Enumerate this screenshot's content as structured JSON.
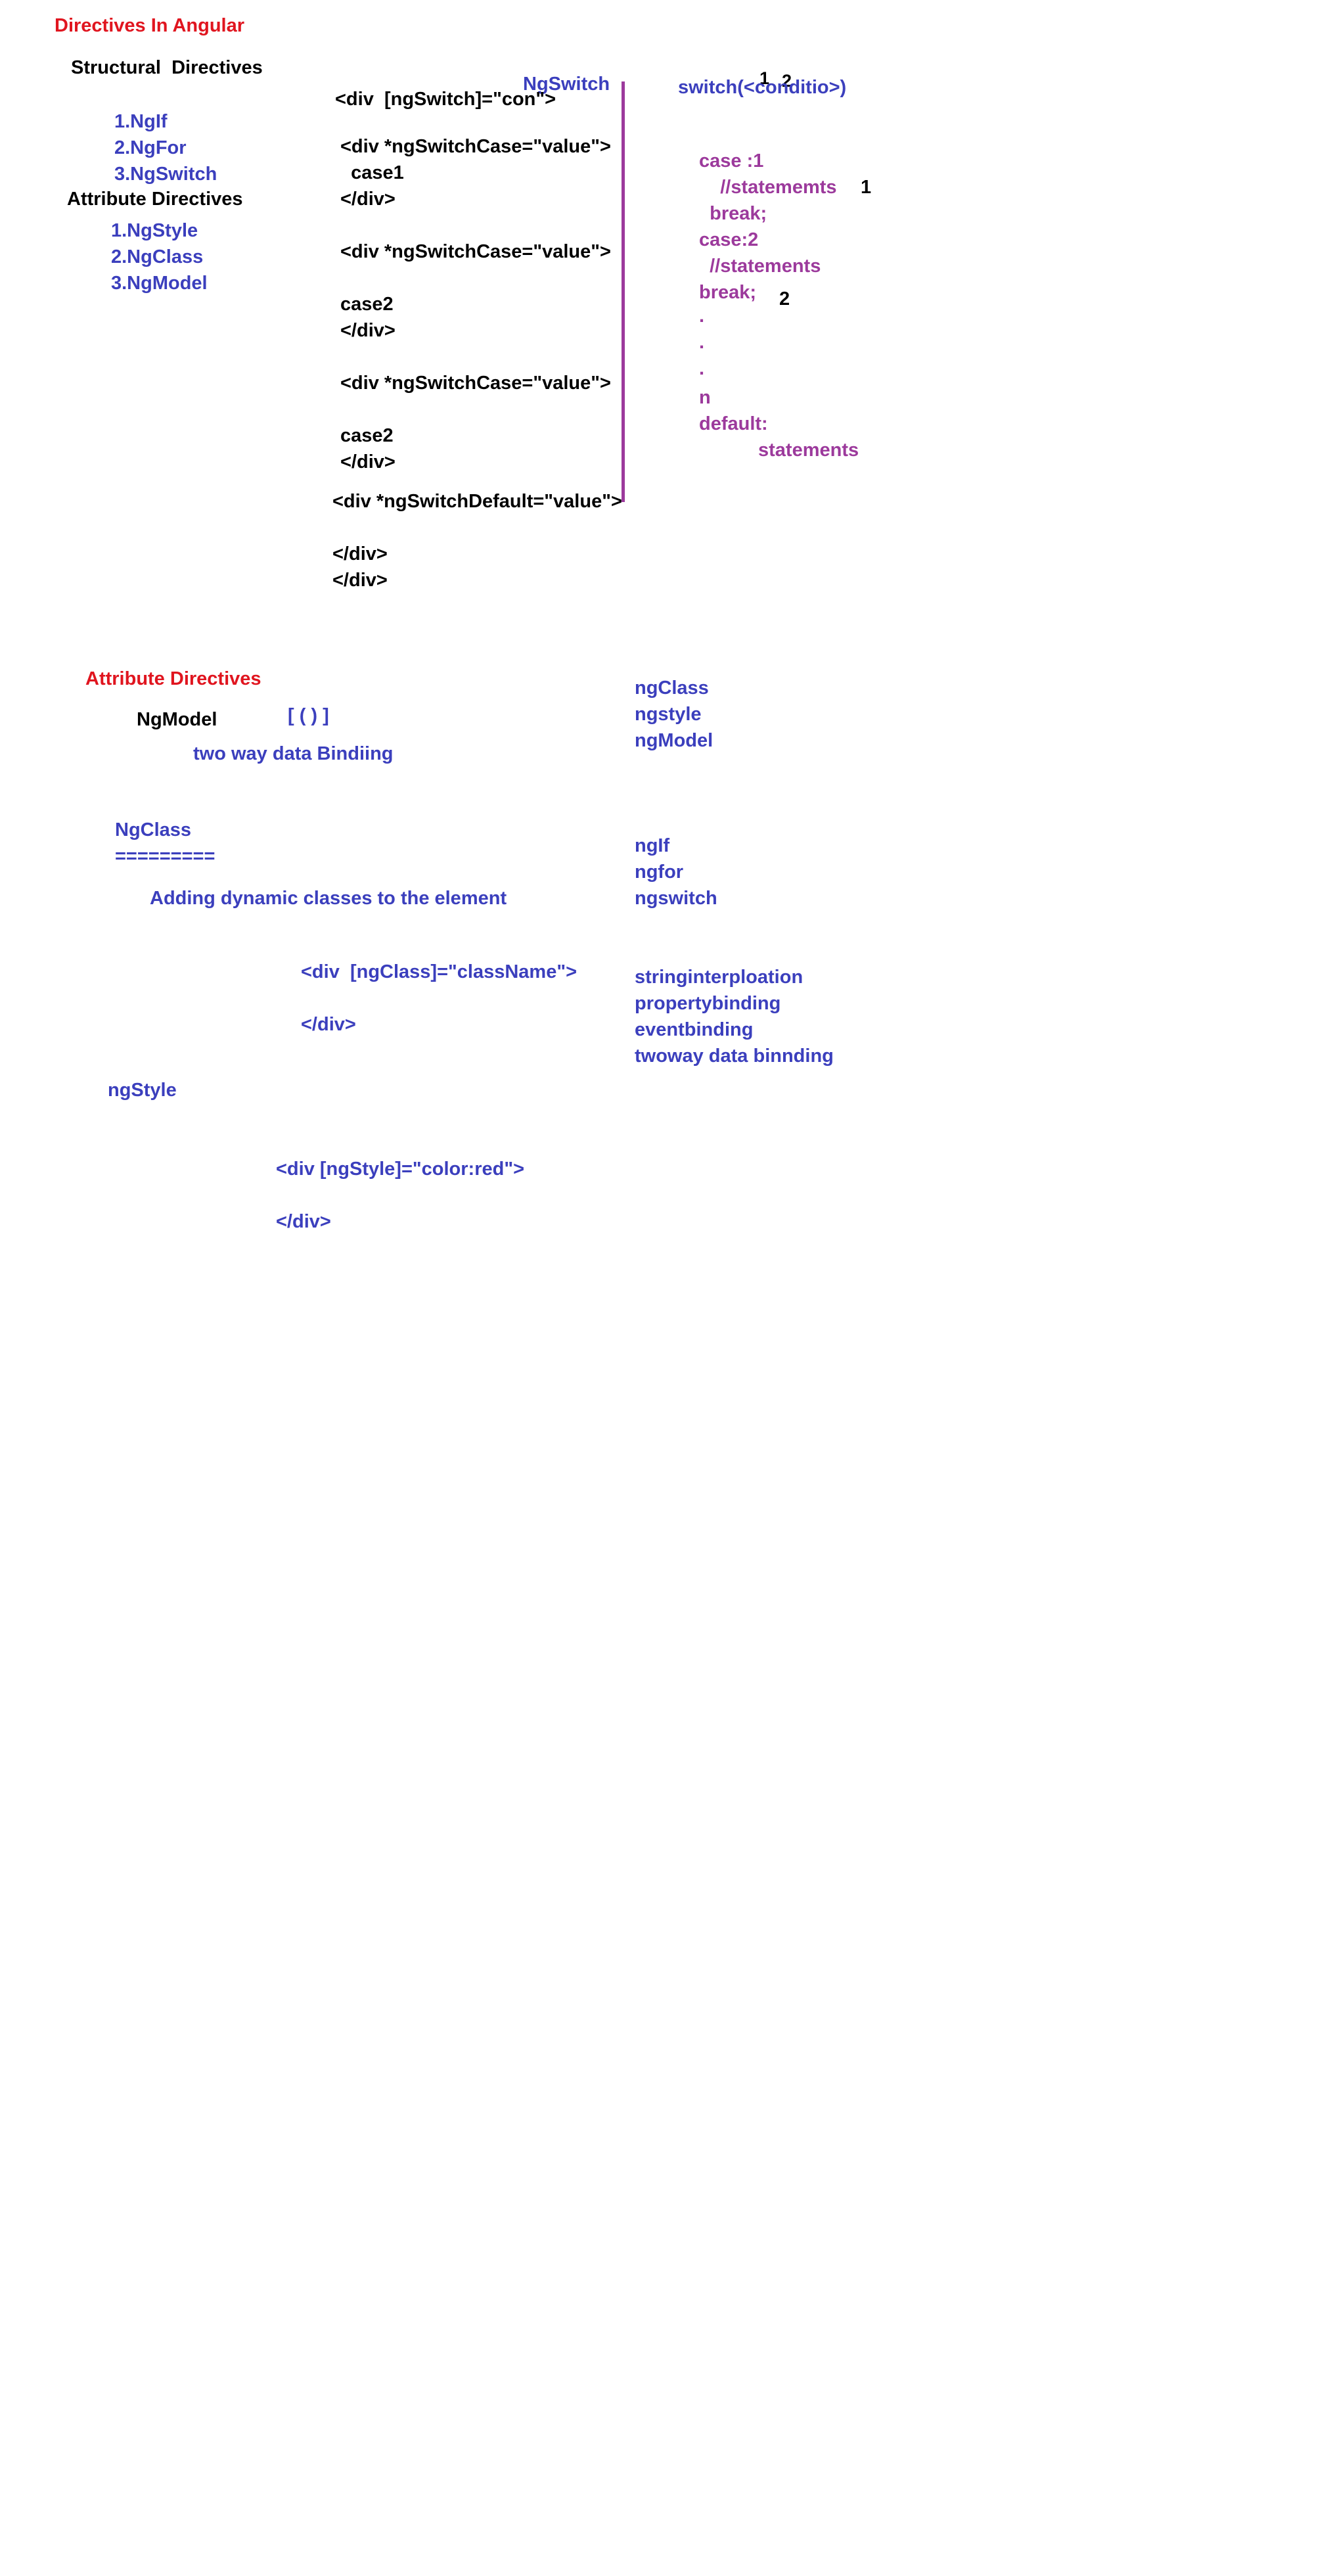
{
  "colors": {
    "red": "#e0151f",
    "black": "#000000",
    "blue": "#3b3fbd",
    "purple": "#9c3a9c"
  },
  "section1": {
    "title": "Directives In Angular",
    "structural_heading": "Structural  Directives",
    "structural_items": [
      "1.NgIf",
      "2.NgFor",
      "3.NgSwitch"
    ],
    "attribute_heading": "Attribute Directives",
    "attribute_items": [
      "1.NgStyle",
      "2.NgClass",
      "3.NgModel"
    ]
  },
  "ngswitch_code": {
    "label": "NgSwitch",
    "lines": [
      "<div  [ngSwitch]=\"con\">",
      "<div *ngSwitchCase=\"value\">",
      "  case1",
      "</div>",
      "<div *ngSwitchCase=\"value\">",
      "case2",
      "</div>",
      "<div *ngSwitchCase=\"value\">",
      "case2",
      "</div>",
      "<div *ngSwitchDefault=\"value\">",
      "</div>",
      "</div>"
    ]
  },
  "switch_code": {
    "header": "switch(<conditio>)",
    "header_marks": [
      "1",
      "2"
    ],
    "lines": [
      "case :1",
      "    //statememts",
      "  break;",
      "case:2",
      "  //statements",
      "break;",
      ".",
      ".",
      ".",
      "n",
      "default:",
      "statements"
    ],
    "marks": [
      "1",
      "2"
    ]
  },
  "section2": {
    "title": "Attribute Directives",
    "ngmodel_label": "NgModel",
    "ngmodel_syntax": "[ ( ) ]",
    "ngmodel_desc": "two way data Bindiing",
    "ngclass_label": "NgClass",
    "ngclass_underline": "=========",
    "ngclass_desc": "Adding dynamic classes to the element",
    "ngclass_code": [
      "<div  [ngClass]=\"className\">",
      "</div>"
    ],
    "ngstyle_label": "ngStyle",
    "ngstyle_code": [
      "<div [ngStyle]=\"color:red\">",
      "</div>"
    ]
  },
  "right_lists": {
    "attribute": [
      "ngClass",
      "ngstyle",
      "ngModel"
    ],
    "structural": [
      "ngIf",
      "ngfor",
      "ngswitch"
    ],
    "bindings": [
      "stringinterploation",
      "propertybinding",
      "eventbinding",
      "twoway data binnding"
    ]
  }
}
